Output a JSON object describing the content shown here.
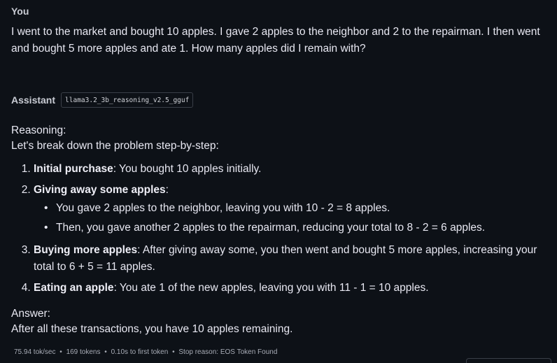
{
  "user": {
    "role": "You",
    "message": "I went to the market and bought 10 apples. I gave 2 apples to the neighbor and 2 to the repairman. I then went and bought 5 more apples and ate 1. How many apples did I remain with?"
  },
  "assistant": {
    "role": "Assistant",
    "model": "llama3.2_3b_reasoning_v2.5_gguf",
    "reasoning_label": "Reasoning:",
    "intro": "Let's break down the problem step-by-step:",
    "steps": [
      {
        "title": "Initial purchase",
        "text": ": You bought 10 apples initially."
      },
      {
        "title": "Giving away some apples",
        "text": ":",
        "sub": [
          "You gave 2 apples to the neighbor, leaving you with 10 - 2 = 8 apples.",
          "Then, you gave another 2 apples to the repairman, reducing your total to 8 - 2 = 6 apples."
        ]
      },
      {
        "title": "Buying more apples",
        "text": ": After giving away some, you then went and bought 5 more apples, increasing your total to 6 + 5 = 11 apples."
      },
      {
        "title": "Eating an apple",
        "text": ": You ate 1 of the new apples, leaving you with 11 - 1 = 10 apples."
      }
    ],
    "answer_label": "Answer:",
    "answer": "After all these transactions, you have 10 apples remaining."
  },
  "stats": {
    "speed": "75.94 tok/sec",
    "tokens": "169 tokens",
    "first_token": "0.10s to first token",
    "stop_reason": "Stop reason: EOS Token Found",
    "separator": "•"
  }
}
